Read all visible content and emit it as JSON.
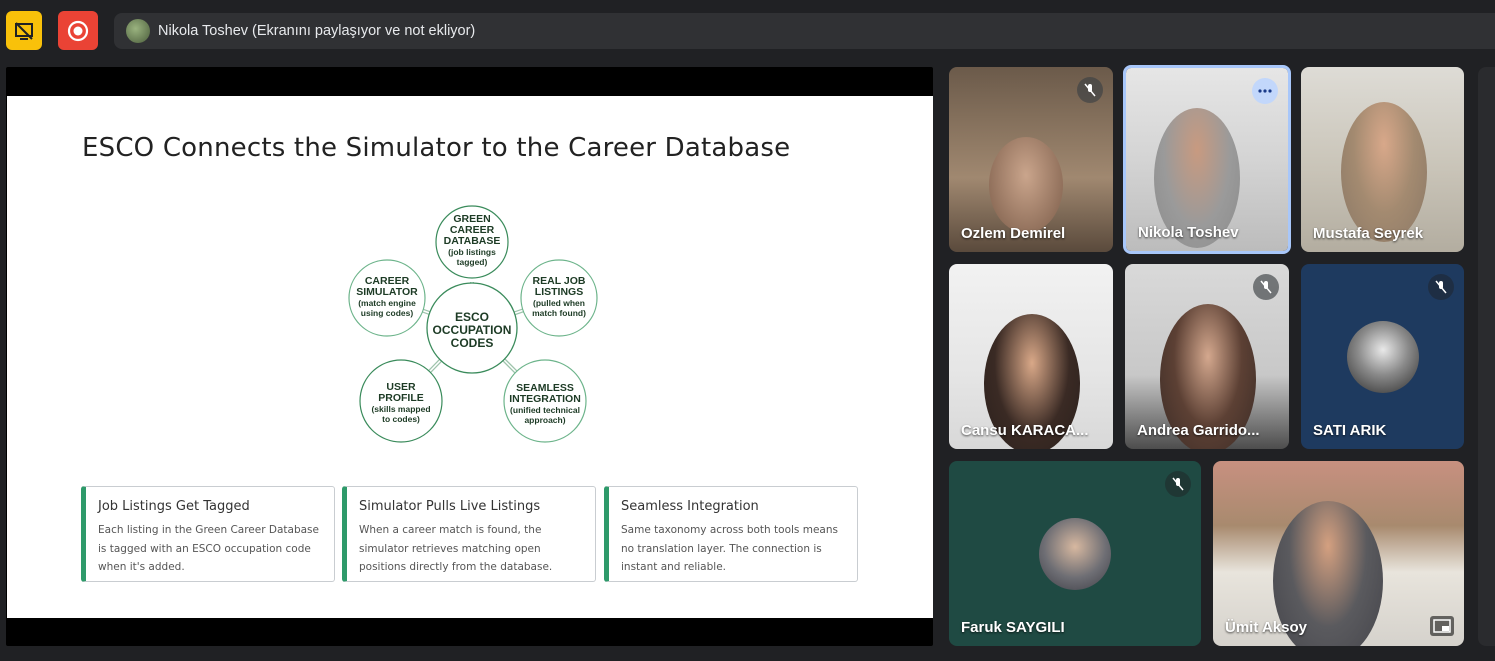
{
  "topbar": {
    "presenter_status": "Nikola Toshev (Ekranını paylaşıyor ve not ekliyor)"
  },
  "slide": {
    "title": "ESCO Connects the Simulator to the Career Database",
    "diagram": {
      "center": [
        "ESCO",
        "OCCUPATION",
        "CODES"
      ],
      "nodes": [
        {
          "lines": [
            "GREEN",
            "CAREER",
            "DATABASE"
          ],
          "sub": [
            "(job listings",
            "tagged)"
          ]
        },
        {
          "lines": [
            "REAL JOB",
            "LISTINGS"
          ],
          "sub": [
            "(pulled when",
            "match found)"
          ]
        },
        {
          "lines": [
            "SEAMLESS",
            "INTEGRATION"
          ],
          "sub": [
            "(unified technical",
            "approach)"
          ]
        },
        {
          "lines": [
            "USER",
            "PROFILE"
          ],
          "sub": [
            "(skills mapped",
            "to codes)"
          ]
        },
        {
          "lines": [
            "CAREER",
            "SIMULATOR"
          ],
          "sub": [
            "(match engine",
            "using codes)"
          ]
        }
      ]
    },
    "cards": [
      {
        "title": "Job Listings Get Tagged",
        "lines": [
          "Each listing in the Green Career Database",
          "is tagged with an ESCO occupation code",
          "when it's added."
        ]
      },
      {
        "title": "Simulator Pulls Live Listings",
        "lines": [
          "When a career match is found, the",
          "simulator retrieves matching open",
          "positions directly from the database."
        ]
      },
      {
        "title": "Seamless Integration",
        "lines": [
          "Same taxonomy across both tools means",
          "no translation layer. The connection is",
          "instant and reliable."
        ]
      }
    ]
  },
  "participants": [
    {
      "name": "Ozlem Demirel",
      "muted": true
    },
    {
      "name": "Nikola Toshev",
      "muted": false,
      "speaking": true
    },
    {
      "name": "Mustafa Seyrek",
      "muted": false
    },
    {
      "name": "Cansu KARACA...",
      "muted": false
    },
    {
      "name": "Andrea Garrido...",
      "muted": true
    },
    {
      "name": "SATI ARIK",
      "muted": true
    },
    {
      "name": "Faruk SAYGILI",
      "muted": true
    },
    {
      "name": "Ümit Aksoy",
      "muted": false
    }
  ],
  "colors": {
    "accent_green": "#2e9a6a",
    "record_red": "#ea4335",
    "present_yellow": "#f9c10a",
    "speaking_ring": "#a8c7fa"
  }
}
